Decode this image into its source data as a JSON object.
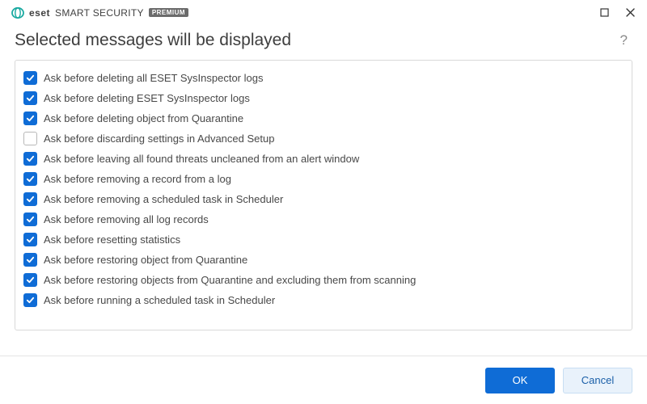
{
  "brand": {
    "eset": "eset",
    "product": "SMART SECURITY",
    "badge": "PREMIUM"
  },
  "header": {
    "title": "Selected messages will be displayed"
  },
  "items": [
    {
      "checked": true,
      "label": "Ask before deleting all ESET SysInspector logs"
    },
    {
      "checked": true,
      "label": "Ask before deleting ESET SysInspector logs"
    },
    {
      "checked": true,
      "label": "Ask before deleting object from Quarantine"
    },
    {
      "checked": false,
      "label": "Ask before discarding settings in Advanced Setup"
    },
    {
      "checked": true,
      "label": "Ask before leaving all found threats uncleaned from an alert window"
    },
    {
      "checked": true,
      "label": "Ask before removing a record from a log"
    },
    {
      "checked": true,
      "label": "Ask before removing a scheduled task in Scheduler"
    },
    {
      "checked": true,
      "label": "Ask before removing all log records"
    },
    {
      "checked": true,
      "label": "Ask before resetting statistics"
    },
    {
      "checked": true,
      "label": "Ask before restoring object from Quarantine"
    },
    {
      "checked": true,
      "label": "Ask before restoring objects from Quarantine and excluding them from scanning"
    },
    {
      "checked": true,
      "label": "Ask before running a scheduled task in Scheduler"
    }
  ],
  "buttons": {
    "ok": "OK",
    "cancel": "Cancel"
  }
}
